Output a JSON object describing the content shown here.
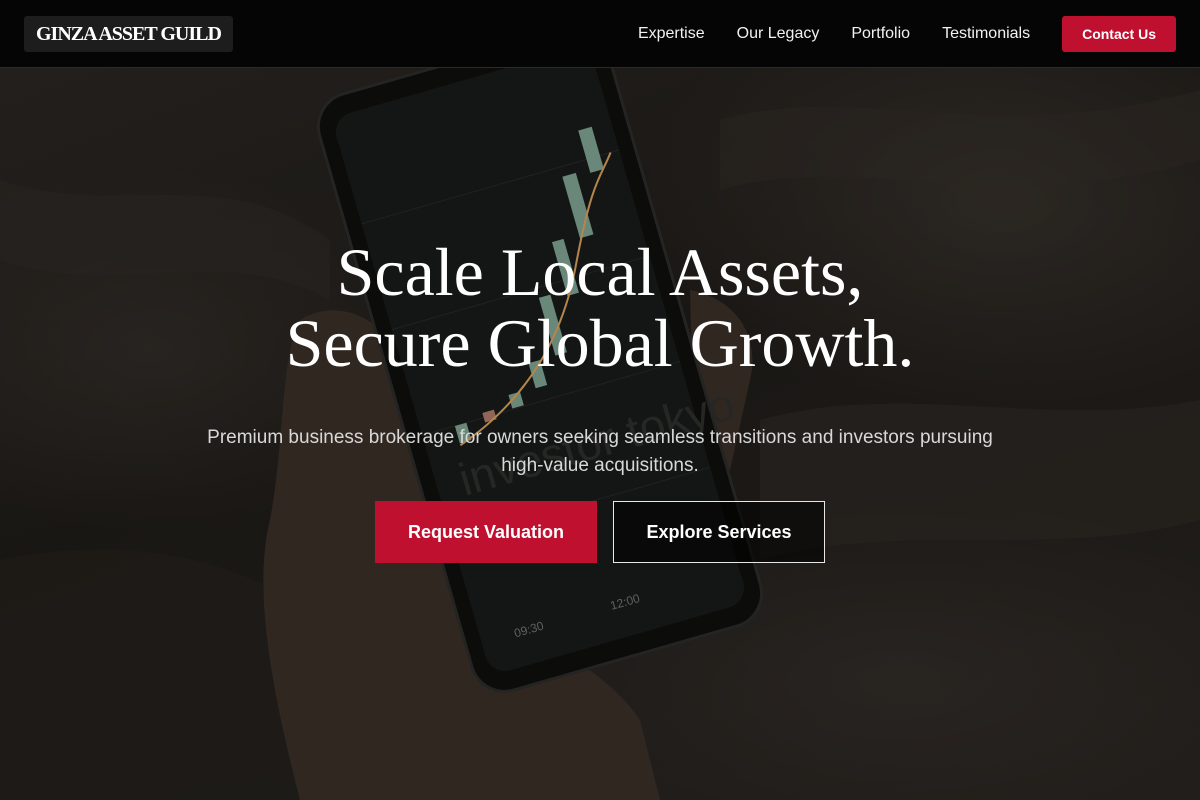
{
  "header": {
    "logo_text": "GINZA ASSET GUILD",
    "nav": [
      {
        "label": "Expertise"
      },
      {
        "label": "Our Legacy"
      },
      {
        "label": "Portfolio"
      },
      {
        "label": "Testimonials"
      }
    ],
    "cta_label": "Contact Us"
  },
  "hero": {
    "title_line1": "Scale Local Assets,",
    "title_line2": "Secure Global Growth.",
    "subtitle": "Premium business brokerage for owners seeking seamless transitions and investors pursuing high-value acquisitions.",
    "primary_button": "Request Valuation",
    "secondary_button": "Explore Services"
  },
  "background_photo": {
    "phone_watermark": "investor tokyo",
    "time_labels": [
      "09:30",
      "12:00"
    ]
  },
  "colors": {
    "accent": "#c0102f",
    "header_bg": "#050505",
    "text": "#ffffff"
  }
}
